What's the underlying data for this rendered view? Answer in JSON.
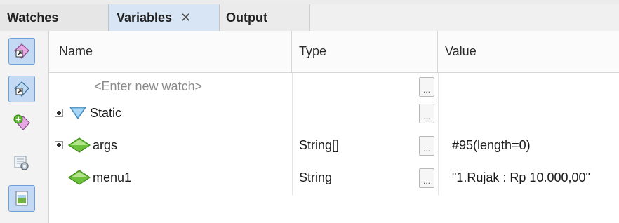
{
  "tabs": [
    {
      "label": "Watches",
      "active": false
    },
    {
      "label": "Variables",
      "active": true,
      "close": "✕"
    },
    {
      "label": "Output",
      "active": false
    }
  ],
  "toolbar": {
    "buttons": [
      {
        "icon": "watch-toggle-icon",
        "selected": true
      },
      {
        "icon": "show-static-icon",
        "selected": true
      },
      {
        "icon": "new-watch-icon",
        "selected": false
      },
      {
        "icon": "settings-icon",
        "selected": false
      },
      {
        "icon": "save-image-icon",
        "selected": true
      }
    ]
  },
  "table": {
    "columns": {
      "name": "Name",
      "type": "Type",
      "value": "Value"
    },
    "new_watch_placeholder": "<Enter new watch>",
    "dots_label": "...",
    "rows": [
      {
        "name": "Static",
        "type": "",
        "value": "",
        "expandable": true,
        "icon": "static-field-icon"
      },
      {
        "name": "args",
        "type": "String[]",
        "value": "#95(length=0)",
        "expandable": true,
        "icon": "local-variable-icon"
      },
      {
        "name": "menu1",
        "type": "String",
        "value": "\"1.Rujak : Rp 10.000,00\"",
        "expandable": false,
        "icon": "local-variable-icon"
      }
    ]
  },
  "colors": {
    "active_tab": "#d7e5f5",
    "variable_icon": "#5cb82e",
    "static_icon": "#6fb4e8"
  }
}
